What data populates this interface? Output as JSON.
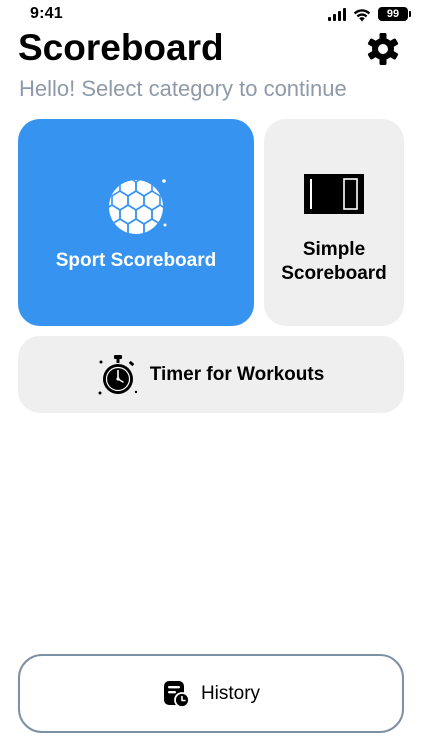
{
  "status_bar": {
    "time": "9:41",
    "battery": "99"
  },
  "header": {
    "title": "Scoreboard",
    "subtitle": "Hello! Select category to continue"
  },
  "categories": [
    {
      "label": "Sport Scoreboard",
      "icon": "soccer-ball-icon",
      "color": "#3793f0"
    },
    {
      "label": "Simple Scoreboard",
      "icon": "scoreboard-icon"
    },
    {
      "label": "Timer for Workouts",
      "icon": "stopwatch-icon"
    }
  ],
  "history": {
    "label": "History",
    "icon": "history-icon"
  },
  "colors": {
    "accent": "#3793f0",
    "card_bg": "#efefef",
    "subtitle": "#8e9aaa",
    "history_border": "#7d8fa3"
  }
}
